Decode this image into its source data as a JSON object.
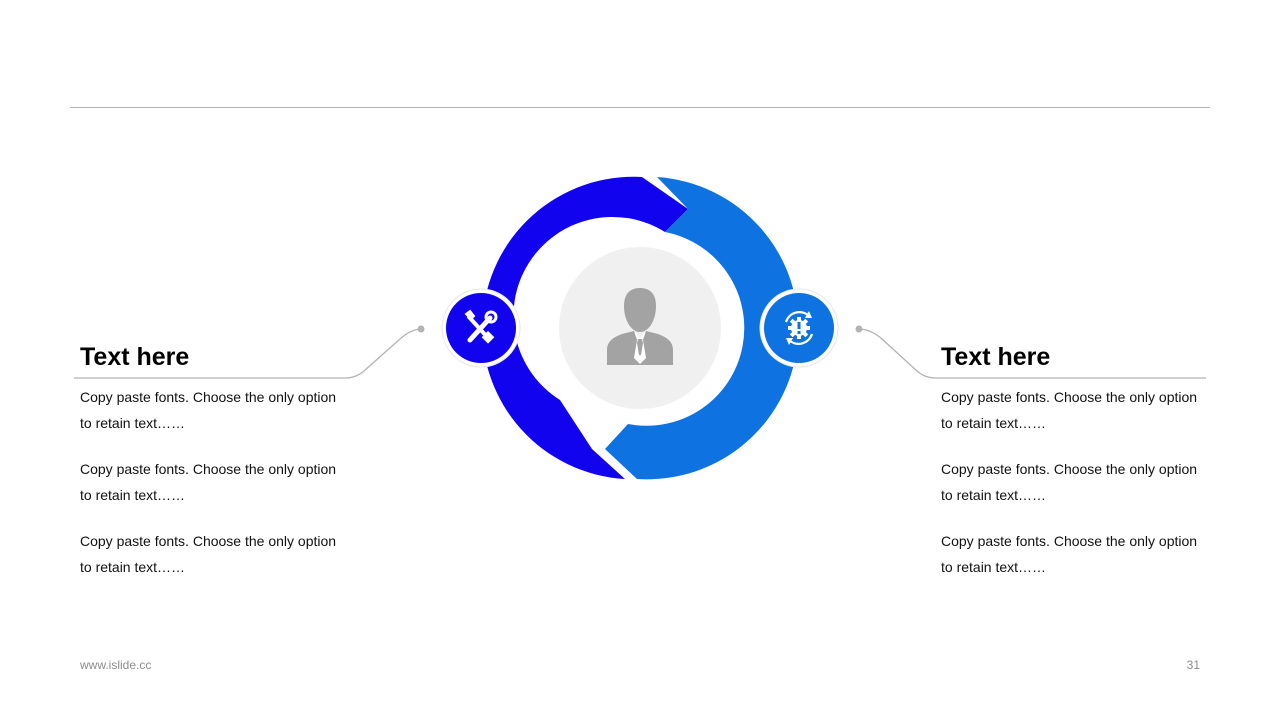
{
  "colors": {
    "accent_primary": "#1203ee",
    "accent_secondary": "#0e72e0",
    "center_fill": "#f0f0f0",
    "person_icon": "#a3a3a3",
    "rule": "#b3b3b3",
    "footer_text": "#8c8c8c"
  },
  "diagram": {
    "center_icon": "businessman-icon",
    "left_icon": "tools-icon",
    "right_icon": "gear-cycle-icon"
  },
  "left_block": {
    "title": "Text here",
    "paragraphs": [
      "Copy paste fonts. Choose the only option to retain text……",
      "Copy paste fonts. Choose the only option to retain text……",
      "Copy paste fonts. Choose the only option to retain text……"
    ]
  },
  "right_block": {
    "title": "Text here",
    "paragraphs": [
      "Copy paste fonts. Choose the only option to retain text……",
      "Copy paste fonts. Choose the only option to retain text……",
      "Copy paste fonts. Choose the only option to retain text……"
    ]
  },
  "footer": {
    "url": "www.islide.cc",
    "page_number": "31"
  }
}
